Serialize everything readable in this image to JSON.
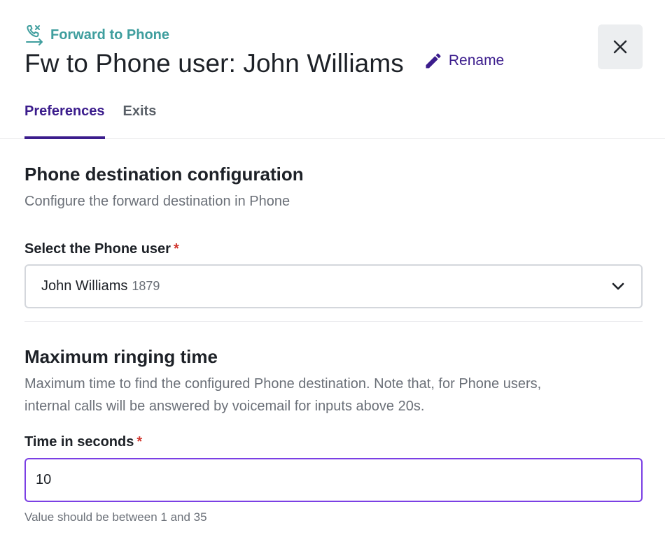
{
  "header": {
    "kicker": "Forward to Phone",
    "title": "Fw to Phone user: John Williams",
    "rename_label": "Rename"
  },
  "tabs": [
    {
      "label": "Preferences",
      "active": true
    },
    {
      "label": "Exits",
      "active": false
    }
  ],
  "destination": {
    "title": "Phone destination configuration",
    "description": "Configure the forward destination in Phone",
    "field_label": "Select the Phone user",
    "required_mark": "*",
    "selected_name": "John Williams",
    "selected_extension": "1879"
  },
  "ringing": {
    "title": "Maximum ringing time",
    "description_line1": "Maximum time to find the configured Phone destination. Note that, for Phone users,",
    "description_line2": "internal calls will be answered by voicemail for inputs above 20s.",
    "field_label": "Time in seconds",
    "required_mark": "*",
    "value": "10",
    "hint": "Value should be between 1 and 35"
  },
  "colors": {
    "accent": "#3b1c8c",
    "teal": "#3f9e9e",
    "focus": "#7b3fe4",
    "required": "#d0342c"
  },
  "icons": {
    "kicker": "phone-forward-icon",
    "rename": "pencil-icon",
    "close": "close-icon",
    "select": "chevron-down-icon"
  }
}
